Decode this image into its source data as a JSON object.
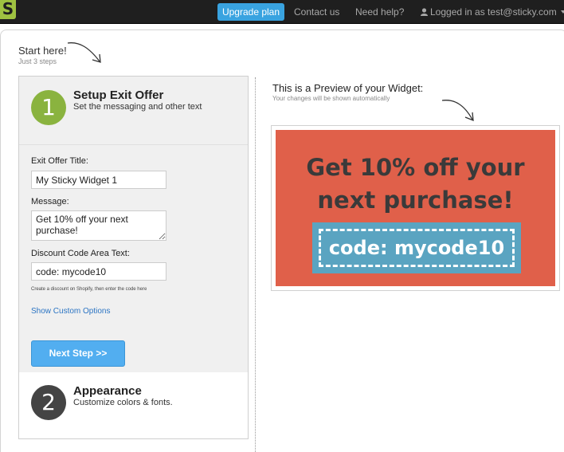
{
  "topbar": {
    "logo": "S",
    "upgrade": "Upgrade plan",
    "contact": "Contact us",
    "help": "Need help?",
    "user": "Logged in as test@sticky.com"
  },
  "intro": {
    "title": "Start here!",
    "subtitle": "Just 3 steps"
  },
  "step1": {
    "number": "1",
    "title": "Setup Exit Offer",
    "desc": "Set the messaging and other text"
  },
  "form": {
    "title_label": "Exit Offer Title:",
    "title_value": "My Sticky Widget 1",
    "message_label": "Message:",
    "message_value": "Get 10% off your next purchase!",
    "code_label": "Discount Code Area Text:",
    "code_value": "code: mycode10",
    "help": "Create a discount on Shopify, then enter the code here",
    "custom_link": "Show Custom Options",
    "next": "Next Step >>"
  },
  "step2": {
    "number": "2",
    "title": "Appearance",
    "desc": "Customize colors & fonts."
  },
  "preview": {
    "title": "This is a Preview of your Widget:",
    "subtitle": "Your changes will be shown automatically",
    "message": "Get 10% off your next purchase!",
    "code": "code: mycode10"
  },
  "colors": {
    "topbar": "#1f1f1f",
    "brand_green": "#8ab33f",
    "accent_blue": "#52aef0",
    "widget_bg": "#e0604a",
    "code_bg": "#5aa4c1"
  }
}
